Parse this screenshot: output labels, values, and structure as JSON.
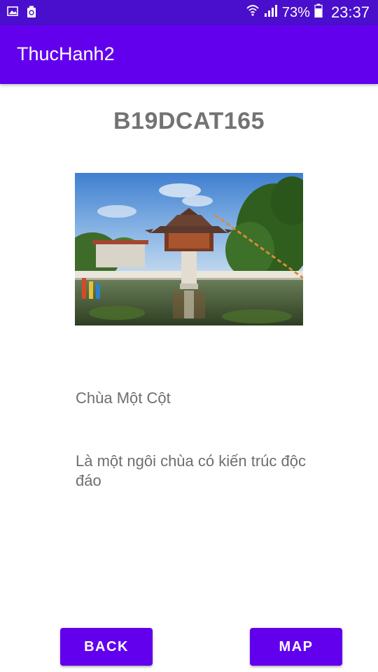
{
  "status_bar": {
    "left_icons": [
      "image-notification-icon",
      "recycle-notification-icon"
    ],
    "battery_percent": "73%",
    "time": "23:37"
  },
  "app_bar": {
    "title": "ThucHanh2"
  },
  "content": {
    "student_id": "B19DCAT165",
    "photo_icon": "pagoda-photo",
    "place_name": "Chùa Một Cột",
    "place_description": "Là một ngôi chùa có kiến trúc độc đáo"
  },
  "buttons": {
    "back_label": "BACK",
    "map_label": "MAP"
  },
  "colors": {
    "status_bar": "#4a0fcc",
    "primary": "#6200ee",
    "text_gray": "#737373"
  }
}
